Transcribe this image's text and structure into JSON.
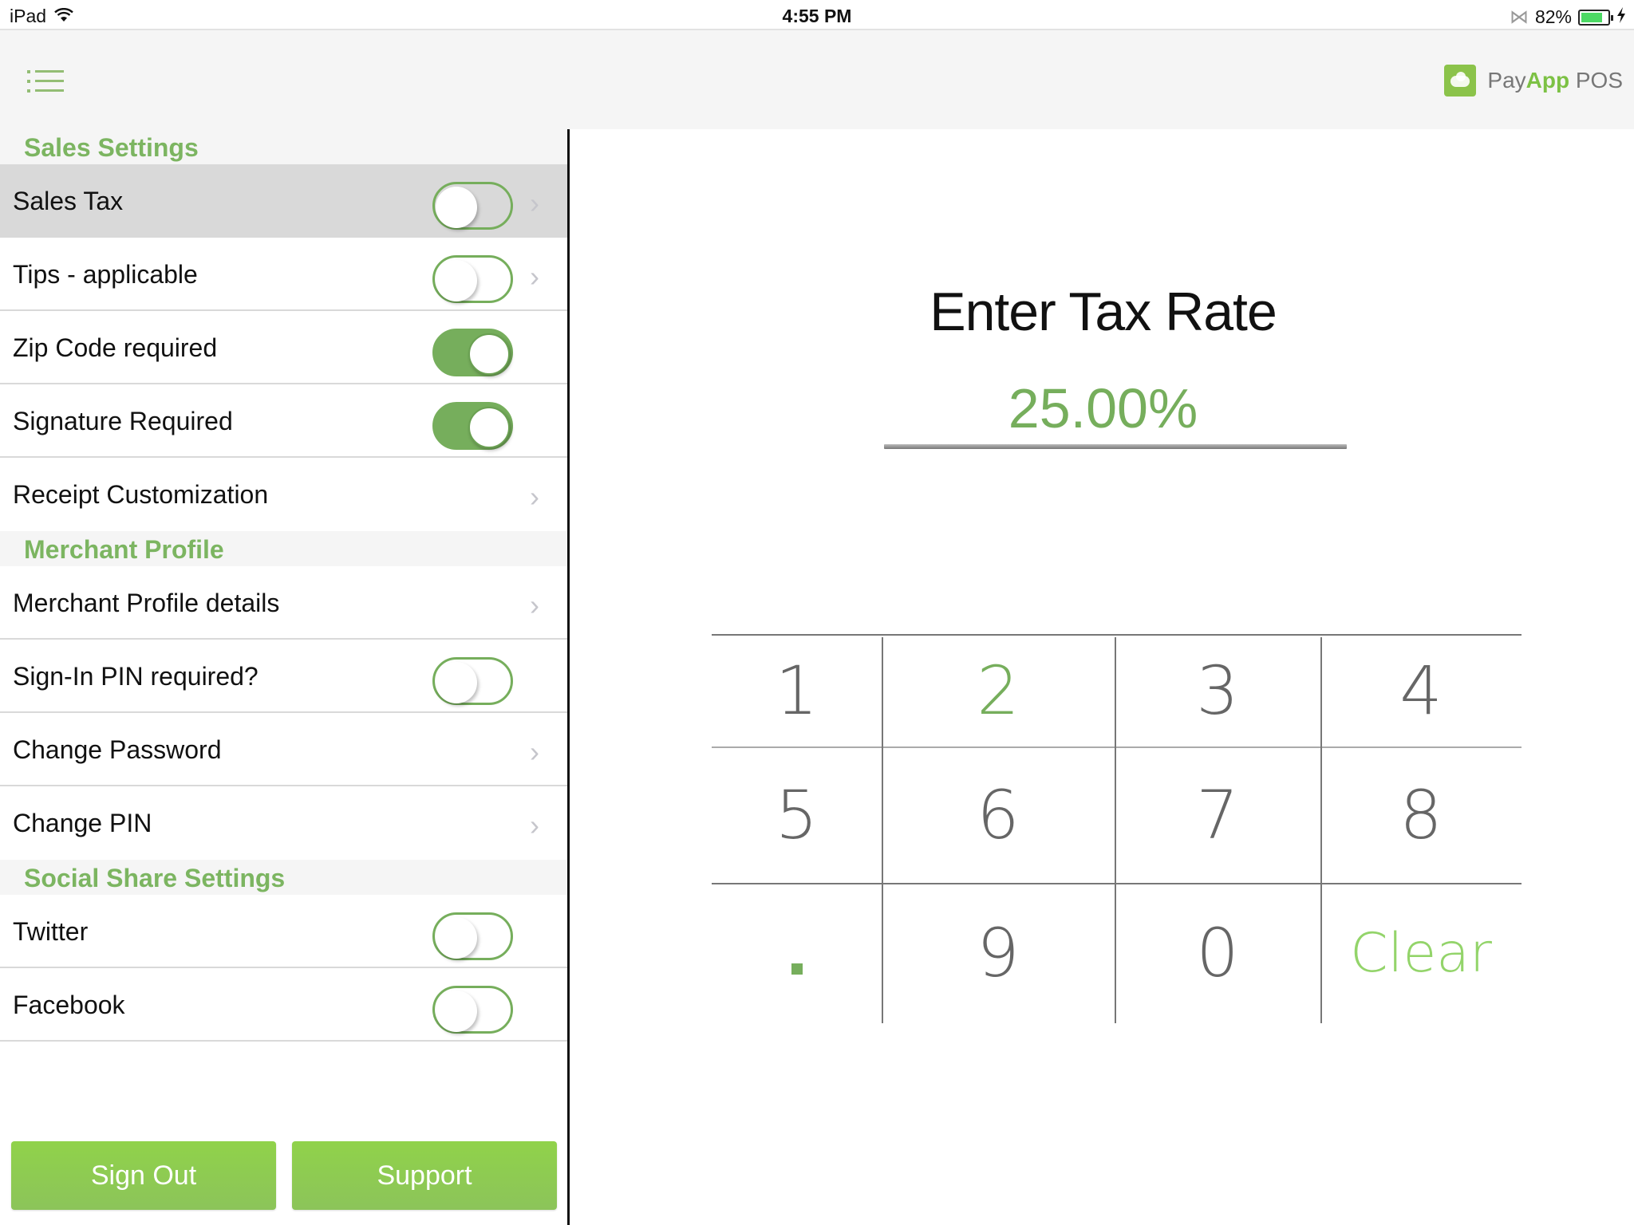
{
  "status_bar": {
    "device": "iPad",
    "time": "4:55 PM",
    "battery_percent": "82%",
    "battery_level": 0.82,
    "icons": [
      "wifi-icon",
      "bluetooth-icon",
      "battery-icon",
      "charging-icon"
    ]
  },
  "header": {
    "menu_icon": "list-menu-icon",
    "brand": {
      "pay": "Pay",
      "app": "App",
      "pos": " POS"
    }
  },
  "colors": {
    "accent": "#76ae5c",
    "button": "#8cc64e",
    "section_header": "#7cb561",
    "selected_row": "#d9d9d9"
  },
  "sidebar": {
    "sections": [
      {
        "title": "Sales Settings",
        "rows": [
          {
            "label": "Sales Tax",
            "toggle": false,
            "chevron": true,
            "selected": true
          },
          {
            "label": "Tips - applicable",
            "toggle": false,
            "chevron": true
          },
          {
            "label": "Zip Code required",
            "toggle": true
          },
          {
            "label": "Signature Required",
            "toggle": true
          },
          {
            "label": "Receipt Customization",
            "chevron": true
          }
        ]
      },
      {
        "title": "Merchant Profile",
        "rows": [
          {
            "label": "Merchant Profile details",
            "chevron": true
          },
          {
            "label": "Sign-In PIN required?",
            "toggle": false
          },
          {
            "label": "Change Password",
            "chevron": true
          },
          {
            "label": "Change PIN",
            "chevron": true
          }
        ]
      },
      {
        "title": "Social Share Settings",
        "rows": [
          {
            "label": "Twitter",
            "toggle": false
          },
          {
            "label": "Facebook",
            "toggle": false
          }
        ]
      }
    ],
    "buttons": {
      "sign_out": "Sign Out",
      "support": "Support"
    }
  },
  "main": {
    "title": "Enter Tax Rate",
    "rate_value": "25.00%",
    "keypad": {
      "keys": [
        "1",
        "2",
        "3",
        "4",
        "5",
        "6",
        "7",
        "8",
        ".",
        "9",
        "0",
        "Clear"
      ],
      "highlighted": "2"
    }
  }
}
